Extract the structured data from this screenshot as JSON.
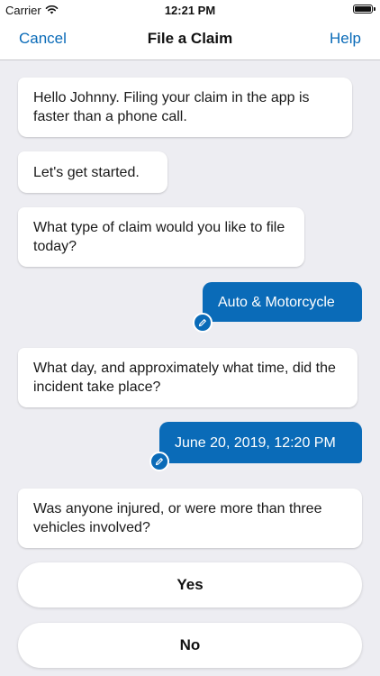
{
  "status_bar": {
    "carrier": "Carrier",
    "time": "12:21 PM",
    "wifi_icon": "wifi-icon",
    "battery_icon": "battery-icon"
  },
  "nav": {
    "cancel_label": "Cancel",
    "title": "File a Claim",
    "help_label": "Help"
  },
  "messages": [
    {
      "from": "bot",
      "text": "Hello Johnny. Filing your claim in the app is faster than a phone call."
    },
    {
      "from": "bot",
      "text": "Let's get started."
    },
    {
      "from": "bot",
      "text": "What type of claim would you like to file today?"
    },
    {
      "from": "user",
      "text": "Auto & Motorcycle",
      "icon": "pencil-icon"
    },
    {
      "from": "bot",
      "text": "What day, and approximately what time, did the incident take place?"
    },
    {
      "from": "user",
      "text": "June 20, 2019, 12:20 PM",
      "icon": "pencil-icon"
    },
    {
      "from": "bot",
      "text": "Was anyone injured, or were more than three vehicles involved?"
    }
  ],
  "choices": {
    "yes_label": "Yes",
    "no_label": "No"
  },
  "colors": {
    "accent": "#0a6bb8",
    "background": "#ededf2"
  }
}
